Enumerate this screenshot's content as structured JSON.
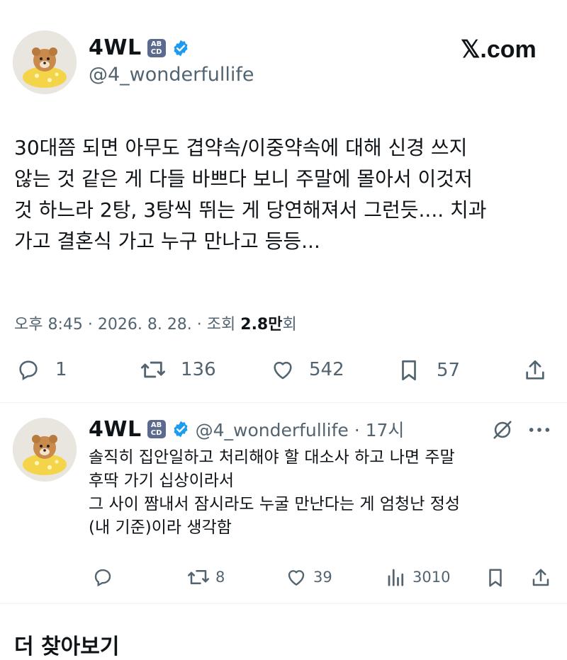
{
  "tweet": {
    "author_name": "4WL",
    "badge_text": "AB\nCD",
    "handle": "@4_wonderfullife",
    "text": "30대쯤 되면 아무도 겹약속/이중약속에 대해 신경 쓰지 않는 것 같은 게 다들 바쁘다 보니 주말에 몰아서 이것저 것 하느라 2탕, 3탕씩 뛰는 게 당연해져서 그런듯.... 치과 가고 결혼식 가고 누구 만나고 등등...",
    "lines": [
      "30대쯤 되면 아무도 겹약속/이중약속에 대해 신경 쓰지",
      "않는 것 같은 게 다들 바쁘다 보니 주말에 몰아서 이것저",
      "것 하느라 2탕, 3탕씩 뛰는 게 당연해져서 그런듯.... 치과",
      "가고 결혼식 가고 누구 만나고 등등..."
    ],
    "timestamp": "오후 8:45 · 2026. 8. 28. · 조회",
    "views": "2.8만",
    "views_suffix": "회",
    "replies": "1",
    "retweets": "136",
    "likes": "542",
    "bookmarks": "57"
  },
  "watermark": "𝕏.com",
  "reply": {
    "author_name": "4WL",
    "handle_time": "@4_wonderfullife · 17시",
    "lines": [
      "솔직히 집안일하고 처리해야 할 대소사 하고 나면 주말",
      "후딱 가기 십상이라서",
      "그 사이 짬내서 잠시라도 누굴 만난다는 게 엄청난 정성",
      "(내 기준)이라 생각함"
    ],
    "retweets": "8",
    "likes": "39",
    "views": "3010"
  },
  "section_title": "더 찾아보기",
  "colors": {
    "verified": "#1d9bf0",
    "secondary": "#536471",
    "text": "#0f1419"
  }
}
